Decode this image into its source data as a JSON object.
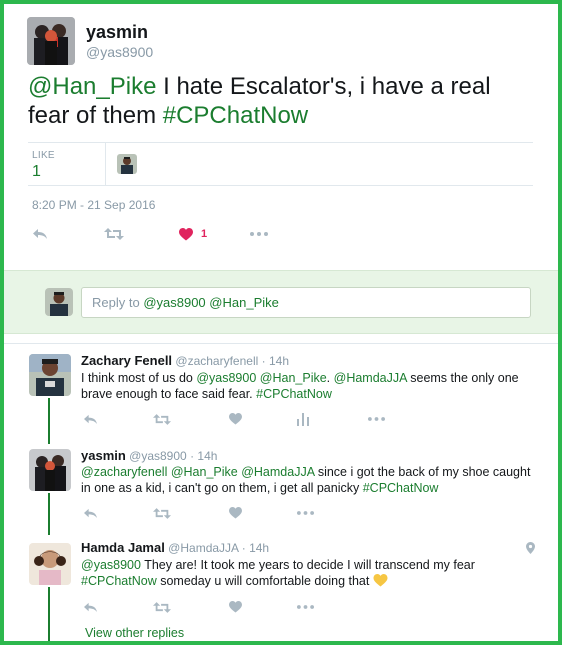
{
  "main": {
    "name": "yasmin",
    "handle": "@yas8900",
    "text_mention": "@Han_Pike",
    "text_body": " I hate Escalator's, i have a real fear of them ",
    "text_hashtag": "#CPChatNow",
    "like_label": "LIKE",
    "like_count": "1",
    "timestamp": "8:20 PM - 21 Sep 2016",
    "heart_count": "1"
  },
  "reply_box": {
    "prefix": "Reply to ",
    "mention1": "@yas8900",
    "mention2": "@Han_Pike"
  },
  "replies": [
    {
      "name": "Zachary Fenell",
      "handle": "@zacharyfenell",
      "dot": "·",
      "time": "14h",
      "p1": "I think most of us do ",
      "m1": "@yas8900",
      "m2": "@Han_Pike",
      "p2": ". ",
      "m3": "@HamdaJJA",
      "p3": " seems the only one brave enough to face said fear. ",
      "tag": "#CPChatNow"
    },
    {
      "name": "yasmin",
      "handle": "@yas8900",
      "dot": "·",
      "time": "14h",
      "m1": "@zacharyfenell",
      "m2": "@Han_Pike",
      "m3": "@HamdaJJA",
      "p1": " since i got the back of my shoe caught in one as a kid, i can't go on them, i get all panicky ",
      "tag": "#CPChatNow"
    },
    {
      "name": "Hamda Jamal",
      "handle": "@HamdaJJA",
      "dot": "·",
      "time": "14h",
      "m1": "@yas8900",
      "p1": " They are! It took me years to decide I will transcend my fear ",
      "tag": "#CPChatNow",
      "p2": " someday u will comfortable doing that "
    }
  ],
  "view_more": "View other replies",
  "colors": {
    "frame": "#2db84d",
    "link": "#1b7d2f",
    "heart": "#e0245e",
    "muted": "#8899a6"
  }
}
